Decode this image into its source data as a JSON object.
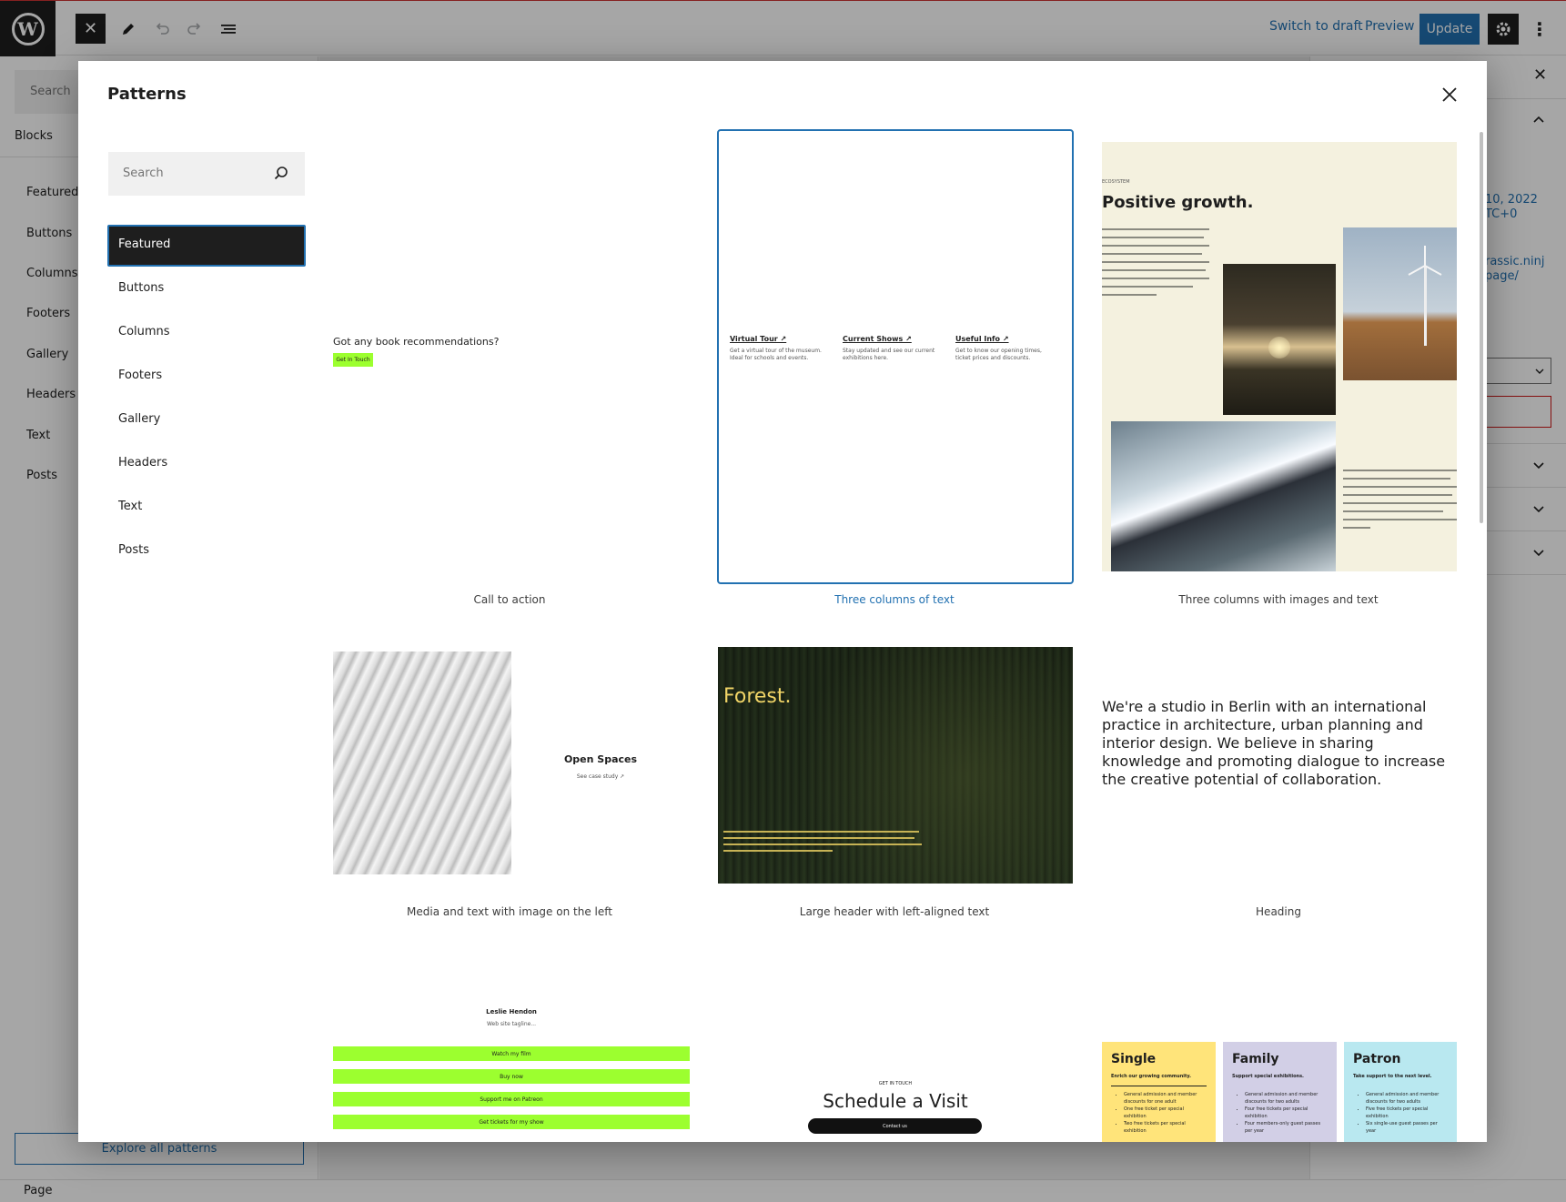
{
  "topbar": {
    "switch_to_draft": "Switch to draft",
    "preview": "Preview",
    "update": "Update",
    "icons": [
      "wordpress-logo",
      "close-icon",
      "pencil-icon",
      "undo-icon",
      "redo-icon",
      "list-view-icon",
      "gear-icon",
      "more-vertical-icon"
    ]
  },
  "background": {
    "inserter_search_placeholder": "Search",
    "blocks_tab": "Blocks",
    "categories": [
      "Featured",
      "Buttons",
      "Columns",
      "Footers",
      "Gallery",
      "Headers",
      "Text",
      "Posts"
    ],
    "explore_all": "Explore all patterns",
    "sidebar_date": "10, 2022\nTC+0",
    "sidebar_url": "rassic.ninj\npage/",
    "status_bar": "Page"
  },
  "modal": {
    "title": "Patterns",
    "search_placeholder": "Search",
    "active_category": "Featured",
    "categories": [
      "Featured",
      "Buttons",
      "Columns",
      "Footers",
      "Gallery",
      "Headers",
      "Text",
      "Posts"
    ],
    "patterns": [
      {
        "label": "Call to action",
        "heading": "Got any book recommendations?",
        "button": "Get In Touch"
      },
      {
        "label": "Three columns of text",
        "columns": [
          {
            "title": "Virtual Tour ↗",
            "text": "Get a virtual tour of the museum. Ideal for schools and events."
          },
          {
            "title": "Current Shows ↗",
            "text": "Stay updated and see our current exhibitions here."
          },
          {
            "title": "Useful Info ↗",
            "text": "Get to know our opening times, ticket prices and discounts."
          }
        ]
      },
      {
        "label": "Three columns with images and text",
        "eyebrow": "ECOSYSTEM",
        "heading": "Positive growth."
      },
      {
        "label": "Media and text with image on the left",
        "heading": "Open Spaces",
        "link": "See case study ↗"
      },
      {
        "label": "Large header with left-aligned text",
        "heading": "Forest."
      },
      {
        "label": "Heading",
        "text": "We're a studio in Berlin with an international practice in architecture, urban planning and interior design. We believe in sharing knowledge and promoting dialogue to increase the creative potential of collaboration."
      },
      {
        "label": "",
        "heading": "Leslie Hendon",
        "subtitle": "Web site tagline...",
        "buttons": [
          "Watch my film",
          "Buy now",
          "Support me on Patreon",
          "Get tickets for my show"
        ]
      },
      {
        "label": "",
        "eyebrow": "GET IN TOUCH",
        "heading": "Schedule a Visit",
        "button": "Contact us"
      },
      {
        "label": "",
        "tiers": [
          {
            "name": "Single",
            "tagline": "Enrich our growing community.",
            "items": [
              "General admission and member discounts for one adult",
              "One free ticket per special exhibition",
              "Two free tickets per special exhibition"
            ],
            "color": "#ffe47a"
          },
          {
            "name": "Family",
            "tagline": "Support special exhibitions.",
            "items": [
              "General admission and member discounts for two adults",
              "Four free tickets per special exhibition",
              "Four members-only guest passes per year"
            ],
            "color": "#d2cfe6"
          },
          {
            "name": "Patron",
            "tagline": "Take support to the next level.",
            "items": [
              "General admission and member discounts for two adults",
              "Five free tickets per special exhibition",
              "Six single-use guest passes per year"
            ],
            "color": "#b9e8f0"
          }
        ]
      }
    ]
  },
  "colors": {
    "accent": "#2271b1",
    "dark": "#1e1e1e",
    "cta_green": "#9cff2f",
    "cream": "#f4f1df",
    "forest_text": "#f1d567"
  }
}
